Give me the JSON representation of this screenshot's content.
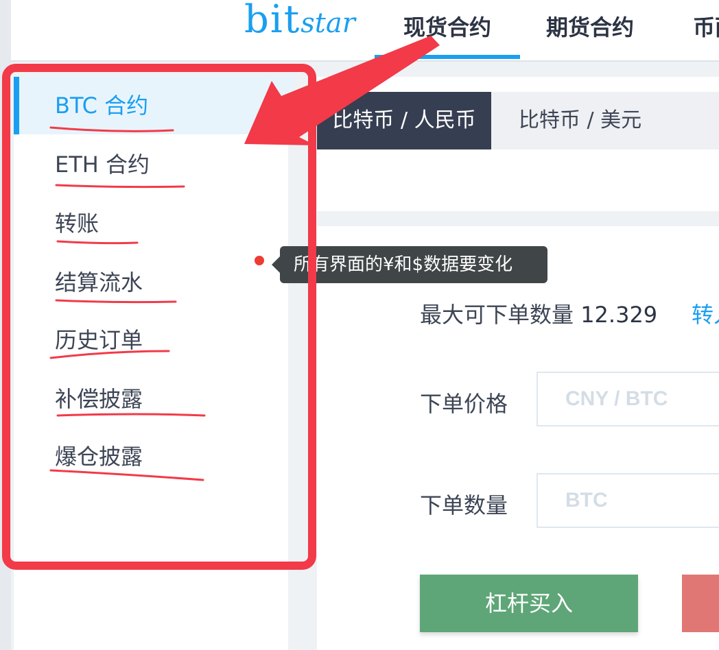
{
  "header": {
    "logo": {
      "part1": "bit",
      "part2": "star"
    },
    "nav_tabs": [
      {
        "label": "现货合约",
        "active": true
      },
      {
        "label": "期货合约",
        "active": false
      },
      {
        "label": "币面",
        "active": false
      }
    ]
  },
  "sidebar": {
    "items": [
      {
        "label": "BTC 合约",
        "active": true
      },
      {
        "label": "ETH 合约",
        "active": false
      },
      {
        "label": "转账",
        "active": false
      },
      {
        "label": "结算流水",
        "active": false
      },
      {
        "label": "历史订单",
        "active": false
      },
      {
        "label": "补偿披露",
        "active": false
      },
      {
        "label": "爆仓披露",
        "active": false
      }
    ]
  },
  "main": {
    "currency_tabs": [
      {
        "label": "比特币 / 人民币",
        "active": true
      },
      {
        "label": "比特币 / 美元",
        "active": false
      }
    ],
    "max_order_label": "最大可下单数量",
    "max_order_value": "12.329",
    "transfer_link": "转入",
    "price_label": "下单价格",
    "price_placeholder": "CNY / BTC",
    "quantity_label": "下单数量",
    "quantity_placeholder": "BTC",
    "buy_button": "杠杆买入"
  },
  "annotation": {
    "tooltip_text": "所有界面的¥和$数据要变化",
    "color": "#f23a48"
  }
}
